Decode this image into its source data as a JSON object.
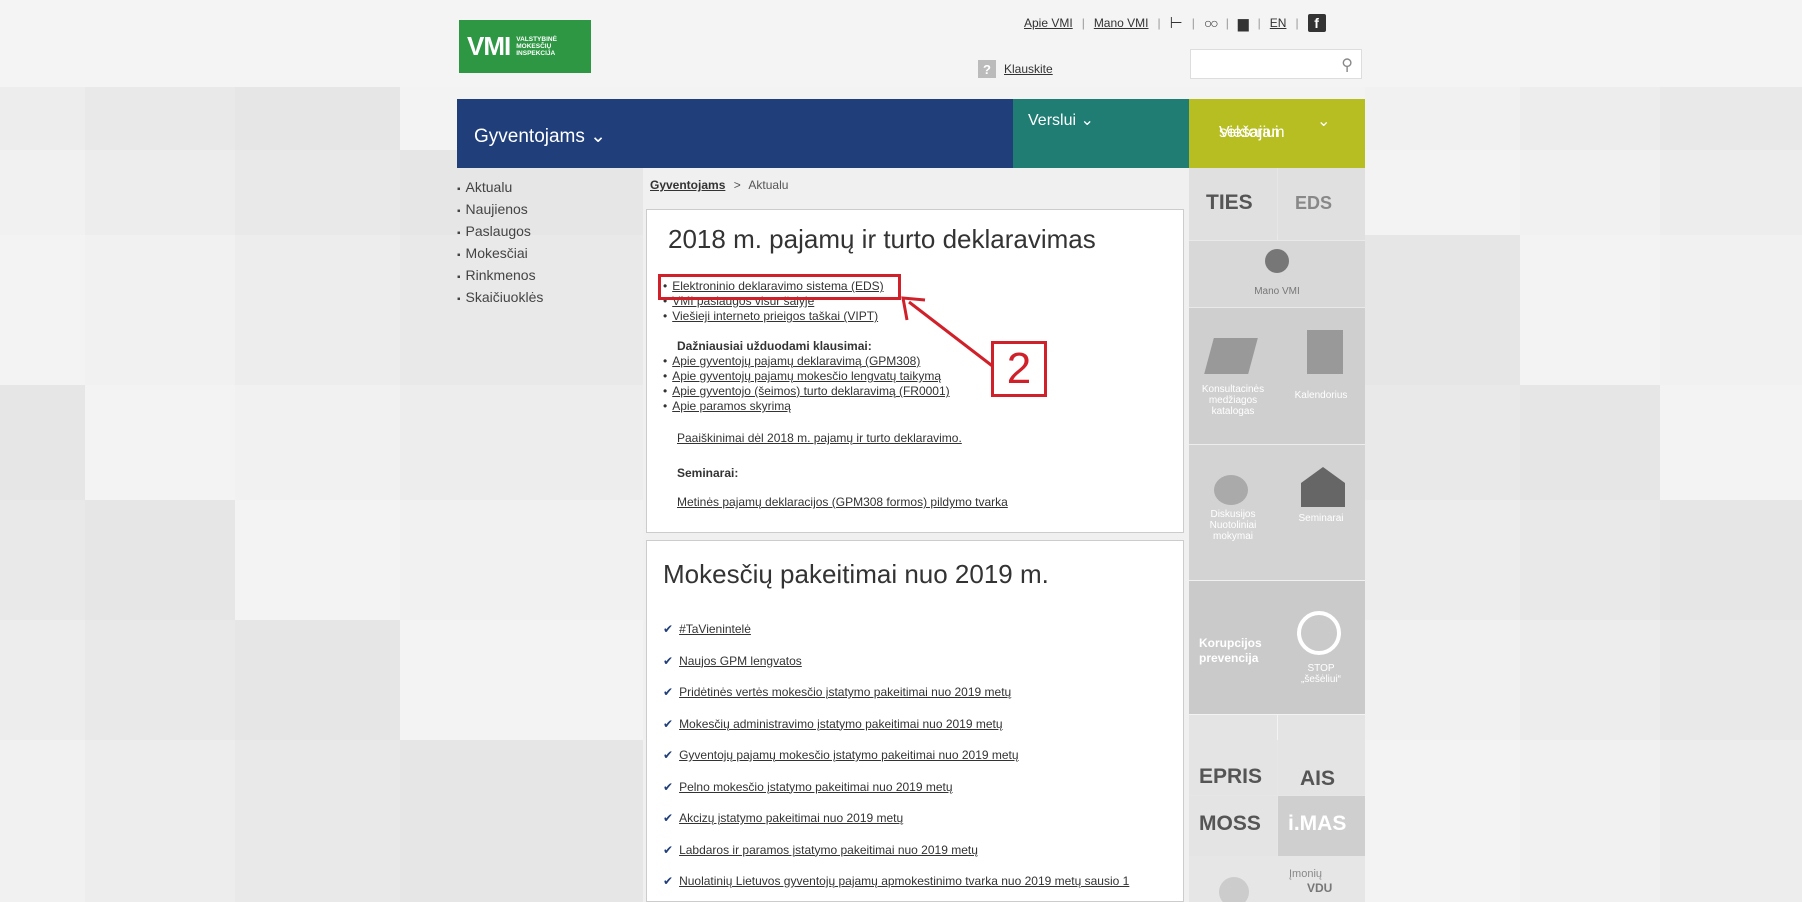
{
  "header": {
    "logo_text": "VMI",
    "logo_subtitle_1": "VALSTYBINĖ",
    "logo_subtitle_2": "MOKESČIŲ",
    "logo_subtitle_3": "INSPEKCIJA",
    "top_links": [
      "Apie VMI",
      "Mano VMI"
    ],
    "lang": "EN",
    "klauskite": "Klauskite",
    "search_placeholder": ""
  },
  "nav": {
    "gyventojams": "Gyventojams ⌄",
    "verslui": "Verslui ⌄",
    "viesajam_1": "Viešajam",
    "viesajam_2": "sektoriui",
    "chev": "⌄"
  },
  "left_menu": [
    "Aktualu",
    "Naujienos",
    "Paslaugos",
    "Mokesčiai",
    "Rinkmenos",
    "Skaičiuoklės"
  ],
  "breadcrumb": {
    "root": "Gyventojams",
    "sep": ">",
    "current": "Aktualu"
  },
  "section1": {
    "title": "2018 m. pajamų ir turto deklaravimas",
    "links": [
      "Elektroninio deklaravimo sistema (EDS)",
      "VMI paslaugos visur šalyje",
      "Viešieji interneto prieigos taškai (VIPT)"
    ],
    "faq_title": "Dažniausiai užduodami klausimai:",
    "faq_links": [
      "Apie gyventojų pajamų deklaravimą (GPM308)",
      "Apie gyventojų pajamų mokesčio lengvatų taikymą",
      "Apie gyventojo (šeimos) turto deklaravimą (FR0001)",
      "Apie paramos skyrimą"
    ],
    "explain": "Paaiškinimai dėl 2018 m. pajamų ir turto deklaravimo.",
    "seminars_title": "Seminarai:",
    "seminar_link": "Metinės pajamų deklaracijos (GPM308 formos) pildymo tvarka"
  },
  "section2": {
    "title": "Mokesčių pakeitimai nuo 2019 m.",
    "items": [
      "#TaVienintelė",
      "Naujos GPM lengvatos",
      "Pridėtinės vertės mokesčio įstatymo pakeitimai nuo 2019 metų",
      "Mokesčių administravimo įstatymo pakeitimai nuo 2019 metų",
      "Gyventojų pajamų mokesčio įstatymo pakeitimai nuo 2019 metų",
      "Pelno mokesčio įstatymo pakeitimai nuo 2019 metų",
      "Akcizų įstatymo pakeitimai nuo 2019 metų",
      "Labdaros ir paramos įstatymo pakeitimai nuo 2019 metų",
      "Nuolatinių Lietuvos gyventojų pajamų apmokestinimo tvarka nuo 2019 metų sausio 1"
    ]
  },
  "annotation_number": "2",
  "right": {
    "ties": "TIES",
    "eds": "EDS",
    "mano_vmi": "Mano VMI",
    "konsult_1": "Konsultacinės",
    "konsult_2": "medžiagos",
    "konsult_3": "katalogas",
    "kalendorius": "Kalendorius",
    "disk_1": "Diskusijos",
    "disk_2": "Nuotoliniai",
    "disk_3": "mokymai",
    "seminarai": "Seminarai",
    "korup_1": "Korupcijos",
    "korup_2": "prevencija",
    "stop_1": "STOP",
    "stop_2": "„šešėliui“",
    "epris": "EPRIS",
    "ais": "AIS",
    "moss": "MOSS",
    "imas": "i.MAS",
    "imoniu": "Įmonių",
    "vdu": "VDU"
  }
}
